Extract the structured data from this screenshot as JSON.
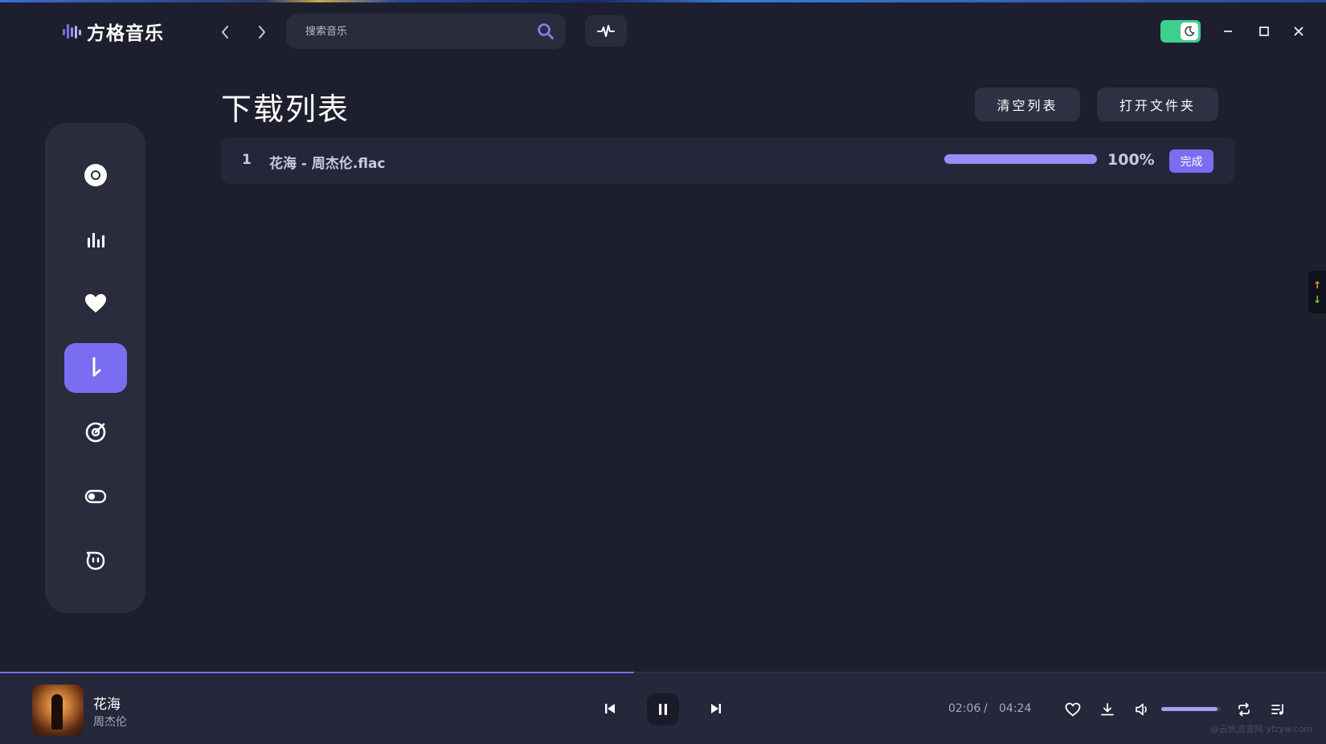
{
  "app": {
    "name": "方格音乐"
  },
  "search": {
    "placeholder": "搜索音乐"
  },
  "colors": {
    "accent": "#7a6df0",
    "background": "#1e1f2e",
    "panel": "#2a2c3e",
    "toggle": "#3ecf8e"
  },
  "sidebar": {
    "items": [
      {
        "icon": "disc-icon",
        "active": false
      },
      {
        "icon": "bar-chart-icon",
        "active": false
      },
      {
        "icon": "heart-icon",
        "active": false
      },
      {
        "icon": "download-icon",
        "active": true
      },
      {
        "icon": "target-icon",
        "active": false
      },
      {
        "icon": "toggle-icon",
        "active": false
      },
      {
        "icon": "chat-icon",
        "active": false
      }
    ]
  },
  "page": {
    "title": "下载列表",
    "clear_button": "清空列表",
    "open_folder_button": "打开文件夹"
  },
  "downloads": [
    {
      "index": "1",
      "name": "花海 - 周杰伦.flac",
      "progress": 1.0,
      "percent_label": "100%",
      "status": "完成"
    }
  ],
  "float_tab": {
    "up": "↑",
    "down": "↓"
  },
  "player": {
    "song_title": "花海",
    "artist": "周杰伦",
    "current_time": "02:06",
    "separator": "/",
    "total_time": "04:24",
    "progress": 0.478,
    "volume": 0.95
  },
  "watermark": "@云帆资源网 yfzyw.com"
}
